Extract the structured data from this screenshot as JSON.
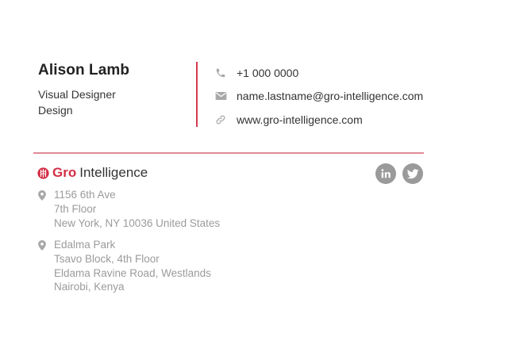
{
  "person": {
    "name": "Alison Lamb",
    "title_line1": "Visual Designer",
    "title_line2": "Design"
  },
  "contacts": {
    "phone": "+1 000 0000",
    "email": "name.lastname@gro-intelligence.com",
    "website": "www.gro-intelligence.com"
  },
  "logo": {
    "brand": "Gro",
    "suffix": "Intelligence"
  },
  "addresses": [
    {
      "lines": [
        "1156 6th Ave",
        "7th Floor",
        "New York, NY 10036 United States"
      ]
    },
    {
      "lines": [
        "Edalma Park",
        "Tsavo Block, 4th Floor",
        "Eldama Ravine Road, Westlands",
        "Nairobi, Kenya"
      ]
    }
  ],
  "socials": {
    "linkedin_text": "in",
    "linkedin_icon": "linkedin-icon",
    "twitter_icon": "twitter-icon"
  },
  "colors": {
    "accent": "#d32f45",
    "divider": "#e08a95",
    "icon_gray": "#9a9a9a",
    "muted_text": "#9b9b9b"
  }
}
